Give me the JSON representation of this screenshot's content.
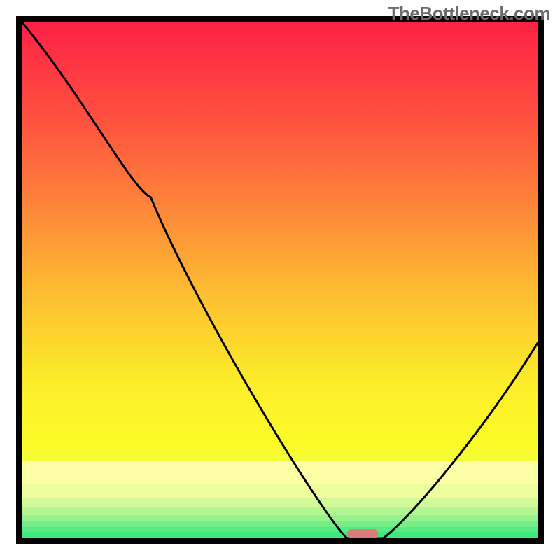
{
  "watermark": "TheBottleneck.com",
  "chart_data": {
    "type": "line",
    "title": "",
    "xlabel": "",
    "ylabel": "",
    "xlim": [
      0,
      100
    ],
    "ylim": [
      0,
      100
    ],
    "x": [
      0,
      25,
      63,
      70,
      100
    ],
    "values": [
      100,
      66,
      0,
      0,
      38
    ],
    "minimum_marker": {
      "x": 66,
      "width": 6,
      "color": "#dc7b7d"
    },
    "gradient_stops": [
      {
        "offset": 0.0,
        "color": "#fe2045"
      },
      {
        "offset": 0.2,
        "color": "#fe543f"
      },
      {
        "offset": 0.38,
        "color": "#fd8d38"
      },
      {
        "offset": 0.55,
        "color": "#fdc530"
      },
      {
        "offset": 0.7,
        "color": "#fced29"
      },
      {
        "offset": 0.82,
        "color": "#fbfc26"
      },
      {
        "offset": 0.93,
        "color": "#d9fa6a"
      },
      {
        "offset": 0.975,
        "color": "#3fe87c"
      },
      {
        "offset": 1.0,
        "color": "#3fe87c"
      }
    ]
  }
}
